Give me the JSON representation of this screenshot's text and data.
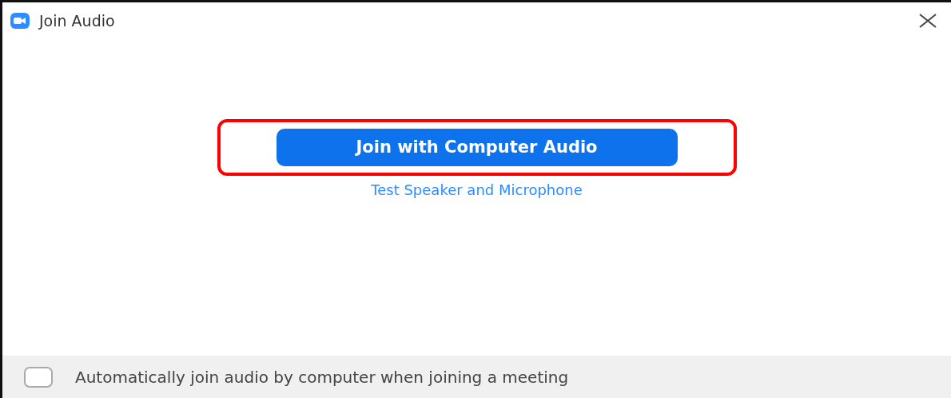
{
  "window": {
    "title": "Join Audio"
  },
  "join_button": {
    "label": "Join with Computer Audio",
    "highlighted": true
  },
  "test_link": {
    "label": "Test Speaker and Microphone"
  },
  "auto_join": {
    "label": "Automatically join audio by computer when joining a meeting",
    "checked": false
  }
}
